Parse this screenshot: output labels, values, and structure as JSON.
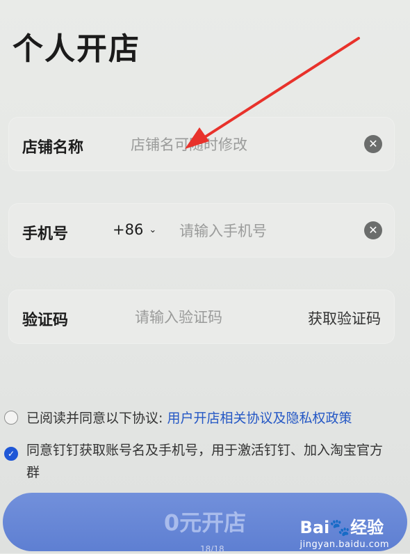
{
  "page_title": "个人开店",
  "shop_name": {
    "label": "店铺名称",
    "placeholder": "店铺名可随时修改",
    "clear_glyph": "✕"
  },
  "phone": {
    "label": "手机号",
    "country_code": "+86",
    "chevron_glyph": "⌄",
    "placeholder": "请输入手机号",
    "clear_glyph": "✕"
  },
  "verify": {
    "label": "验证码",
    "placeholder": "请输入验证码",
    "get_code": "获取验证码"
  },
  "agreement1": {
    "checked": false,
    "text": "已阅读并同意以下协议: ",
    "link": "用户开店相关协议及隐私权政策"
  },
  "agreement2": {
    "checked": true,
    "check_glyph": "✓",
    "text": "同意钉钉获取账号名及手机号，用于激活钉钉、加入淘宝官方群"
  },
  "submit_label": "0元开店",
  "watermark": {
    "brand": "Bai🐾经验",
    "url": "jingyan.baidu.com"
  },
  "page_indicator": "18/18",
  "colors": {
    "accent": "#1f57d6",
    "button": "#5e7fd2",
    "arrow": "#e8322b"
  }
}
